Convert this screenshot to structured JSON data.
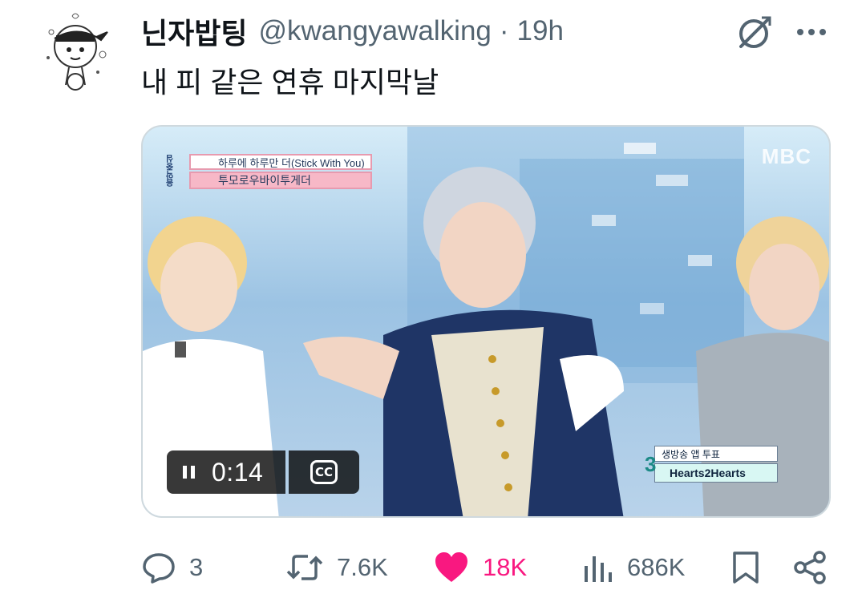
{
  "tweet": {
    "display_name": "닌자밥팅",
    "handle": "@kwangyawalking",
    "separator": "·",
    "time": "19h",
    "text": "내 피 같은 연휴 마지막날"
  },
  "media": {
    "program_tag": "음악중심",
    "song_title": "하루에 하루만 더(Stick With You)",
    "artist": "투모로우바이투게더",
    "broadcaster_logo": "MBC",
    "vote_label": "생방송 앱 투표",
    "vote_rank": "3",
    "vote_song": "Hearts2Hearts",
    "player": {
      "time": "0:14",
      "cc_label": "CC",
      "state": "playing"
    }
  },
  "actions": {
    "replies": "3",
    "reposts": "7.6K",
    "likes": "18K",
    "views": "686K"
  },
  "colors": {
    "text_primary": "#0f1419",
    "text_secondary": "#536471",
    "like_active": "#f91880",
    "border": "#cfd9de"
  },
  "icons": [
    "grok-icon",
    "more-icon",
    "pause-icon",
    "cc-icon",
    "reply-icon",
    "repost-icon",
    "like-icon",
    "views-icon",
    "bookmark-icon",
    "share-icon"
  ]
}
